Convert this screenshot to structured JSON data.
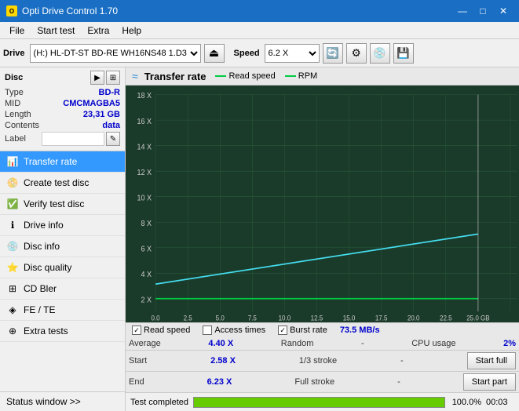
{
  "titleBar": {
    "title": "Opti Drive Control 1.70",
    "minBtn": "—",
    "maxBtn": "□",
    "closeBtn": "✕"
  },
  "menuBar": {
    "items": [
      "File",
      "Start test",
      "Extra",
      "Help"
    ]
  },
  "toolbar": {
    "driveLabel": "Drive",
    "driveName": "(H:) HL-DT-ST BD-RE  WH16NS48 1.D3",
    "speedLabel": "Speed",
    "speedValue": "6.2 X"
  },
  "disc": {
    "title": "Disc",
    "typeLabel": "Type",
    "typeValue": "BD-R",
    "midLabel": "MID",
    "midValue": "CMCMAGBA5",
    "lengthLabel": "Length",
    "lengthValue": "23,31 GB",
    "contentsLabel": "Contents",
    "contentsValue": "data",
    "labelLabel": "Label"
  },
  "nav": {
    "items": [
      {
        "id": "transfer-rate",
        "label": "Transfer rate",
        "icon": "≈",
        "active": true
      },
      {
        "id": "create-test-disc",
        "label": "Create test disc",
        "icon": "○"
      },
      {
        "id": "verify-test-disc",
        "label": "Verify test disc",
        "icon": "✓"
      },
      {
        "id": "drive-info",
        "label": "Drive info",
        "icon": "ℹ"
      },
      {
        "id": "disc-info",
        "label": "Disc info",
        "icon": "💿"
      },
      {
        "id": "disc-quality",
        "label": "Disc quality",
        "icon": "★"
      },
      {
        "id": "cd-bler",
        "label": "CD Bler",
        "icon": "⊞"
      },
      {
        "id": "fe-te",
        "label": "FE / TE",
        "icon": "◈"
      },
      {
        "id": "extra-tests",
        "label": "Extra tests",
        "icon": "⊕"
      }
    ],
    "statusWindow": "Status window >>"
  },
  "chart": {
    "title": "Transfer rate",
    "icon": "≈",
    "legend": {
      "readSpeedColor": "#00cc44",
      "readSpeedLabel": "Read speed",
      "rpmColor": "#00cc44",
      "rpmLabel": "RPM"
    },
    "yAxis": [
      "18 X",
      "16 X",
      "14 X",
      "12 X",
      "10 X",
      "8 X",
      "6 X",
      "4 X",
      "2 X"
    ],
    "xAxis": [
      "0.0",
      "2.5",
      "5.0",
      "7.5",
      "10.0",
      "12.5",
      "15.0",
      "17.5",
      "20.0",
      "22.5",
      "25.0 GB"
    ]
  },
  "footer": {
    "readSpeedChecked": true,
    "readSpeedLabel": "Read speed",
    "accessTimesChecked": false,
    "accessTimesLabel": "Access times",
    "burstRateChecked": true,
    "burstRateLabel": "Burst rate",
    "burstRateValue": "73.5 MB/s",
    "stats": {
      "averageLabel": "Average",
      "averageValue": "4.40 X",
      "randomLabel": "Random",
      "randomDash": "-",
      "cpuUsageLabel": "CPU usage",
      "cpuUsageValue": "2%",
      "startLabel": "Start",
      "startValue": "2.58 X",
      "strokeLabel": "1/3 stroke",
      "strokeDash": "-",
      "startFullLabel": "Start full",
      "endLabel": "End",
      "endValue": "6.23 X",
      "fullStrokeLabel": "Full stroke",
      "fullStrokeDash": "-",
      "startPartLabel": "Start part"
    }
  },
  "progressBar": {
    "percent": 100,
    "percentText": "100.0%",
    "statusText": "Test completed",
    "timeText": "00:03"
  }
}
